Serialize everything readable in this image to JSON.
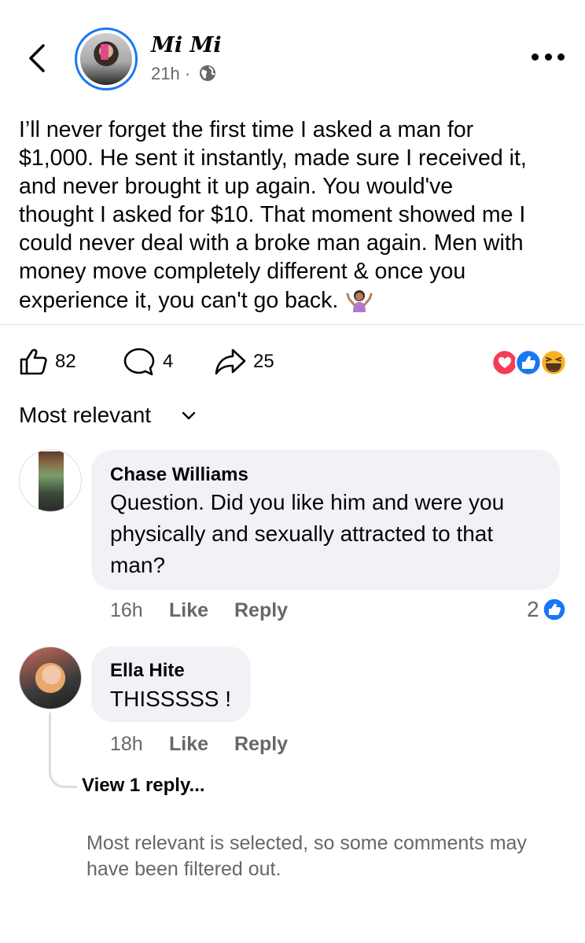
{
  "header": {
    "author_name": "Mi Mi",
    "post_time": "21h ·",
    "icons": {
      "back": "chevron-left-icon",
      "privacy": "globe-icon",
      "more": "more-options-icon"
    }
  },
  "post": {
    "lines": [
      "I’ll never forget the first time I asked a man for",
      "$1,000. He sent it instantly, made sure I received it,",
      "and never brought it up again. You would've",
      "thought I asked for $10. That moment showed me I",
      "could never deal with a broke man again. Men with",
      "money move completely different & once you",
      "experience it, you can't go back."
    ],
    "trailing_emoji": "person-shrugging-emoji"
  },
  "actions": {
    "likes": "82",
    "comments": "4",
    "shares": "25",
    "reactions": [
      "love",
      "like",
      "haha"
    ]
  },
  "sort": {
    "label": "Most relevant"
  },
  "comments": [
    {
      "author": "Chase Williams",
      "text": "Question.  Did you like him and were you physically and sexually attracted to that man?",
      "time": "16h",
      "like_label": "Like",
      "reply_label": "Reply",
      "like_count": "2"
    },
    {
      "author": "Ella Hite",
      "text": "THISSSSS !",
      "time": "18h",
      "like_label": "Like",
      "reply_label": "Reply",
      "view_replies": "View 1 reply..."
    }
  ],
  "footer": {
    "filter_note": "Most relevant is selected, so some comments may have been filtered out."
  },
  "colors": {
    "accent": "#1877f2",
    "love": "#f33e58",
    "haha": "#f7b125",
    "secondary_text": "#65676b",
    "bubble": "#f0f2f5"
  }
}
